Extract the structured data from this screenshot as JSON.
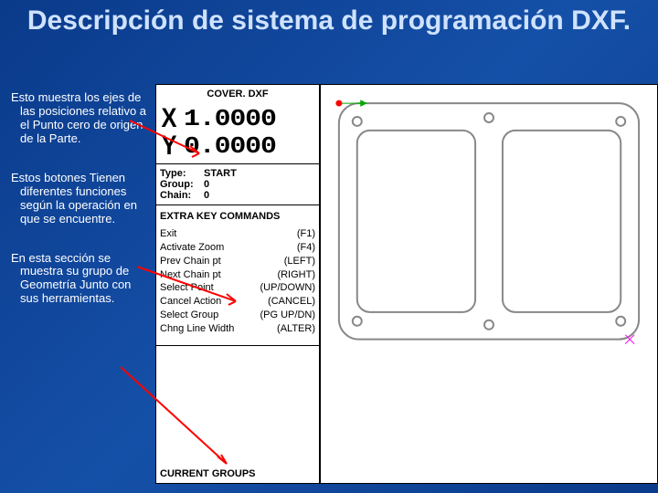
{
  "title": "Descripción de sistema de programación DXF.",
  "sidebar": {
    "para1": "Esto muestra los ejes de las posiciones relativo a el Punto cero de origen de la Parte.",
    "para2": "Estos botones Tienen diferentes funciones según la operación en que se encuentre.",
    "para3": "En esta sección se muestra su grupo de Geometría Junto con sus herramientas."
  },
  "panel": {
    "filename": "COVER. DXF",
    "axes": [
      {
        "name": "X",
        "value": "1.0000"
      },
      {
        "name": "Y",
        "value": "0.0000"
      }
    ],
    "info": {
      "type_label": "Type:",
      "type_value": "START",
      "group_label": "Group:",
      "group_value": "0",
      "chain_label": "Chain:",
      "chain_value": "0"
    },
    "extra_head": "EXTRA KEY COMMANDS",
    "commands": [
      {
        "label": "Exit",
        "key": "(F1)"
      },
      {
        "label": "Activate Zoom",
        "key": "(F4)"
      },
      {
        "label": "Prev Chain pt",
        "key": "(LEFT)"
      },
      {
        "label": "Next Chain pt",
        "key": "(RIGHT)"
      },
      {
        "label": "Select Point",
        "key": "(UP/DOWN)"
      },
      {
        "label": "Cancel Action",
        "key": "(CANCEL)"
      },
      {
        "label": "Select Group",
        "key": "(PG UP/DN)"
      },
      {
        "label": "Chng Line Width",
        "key": "(ALTER)"
      }
    ],
    "current_groups": "CURRENT  GROUPS"
  }
}
